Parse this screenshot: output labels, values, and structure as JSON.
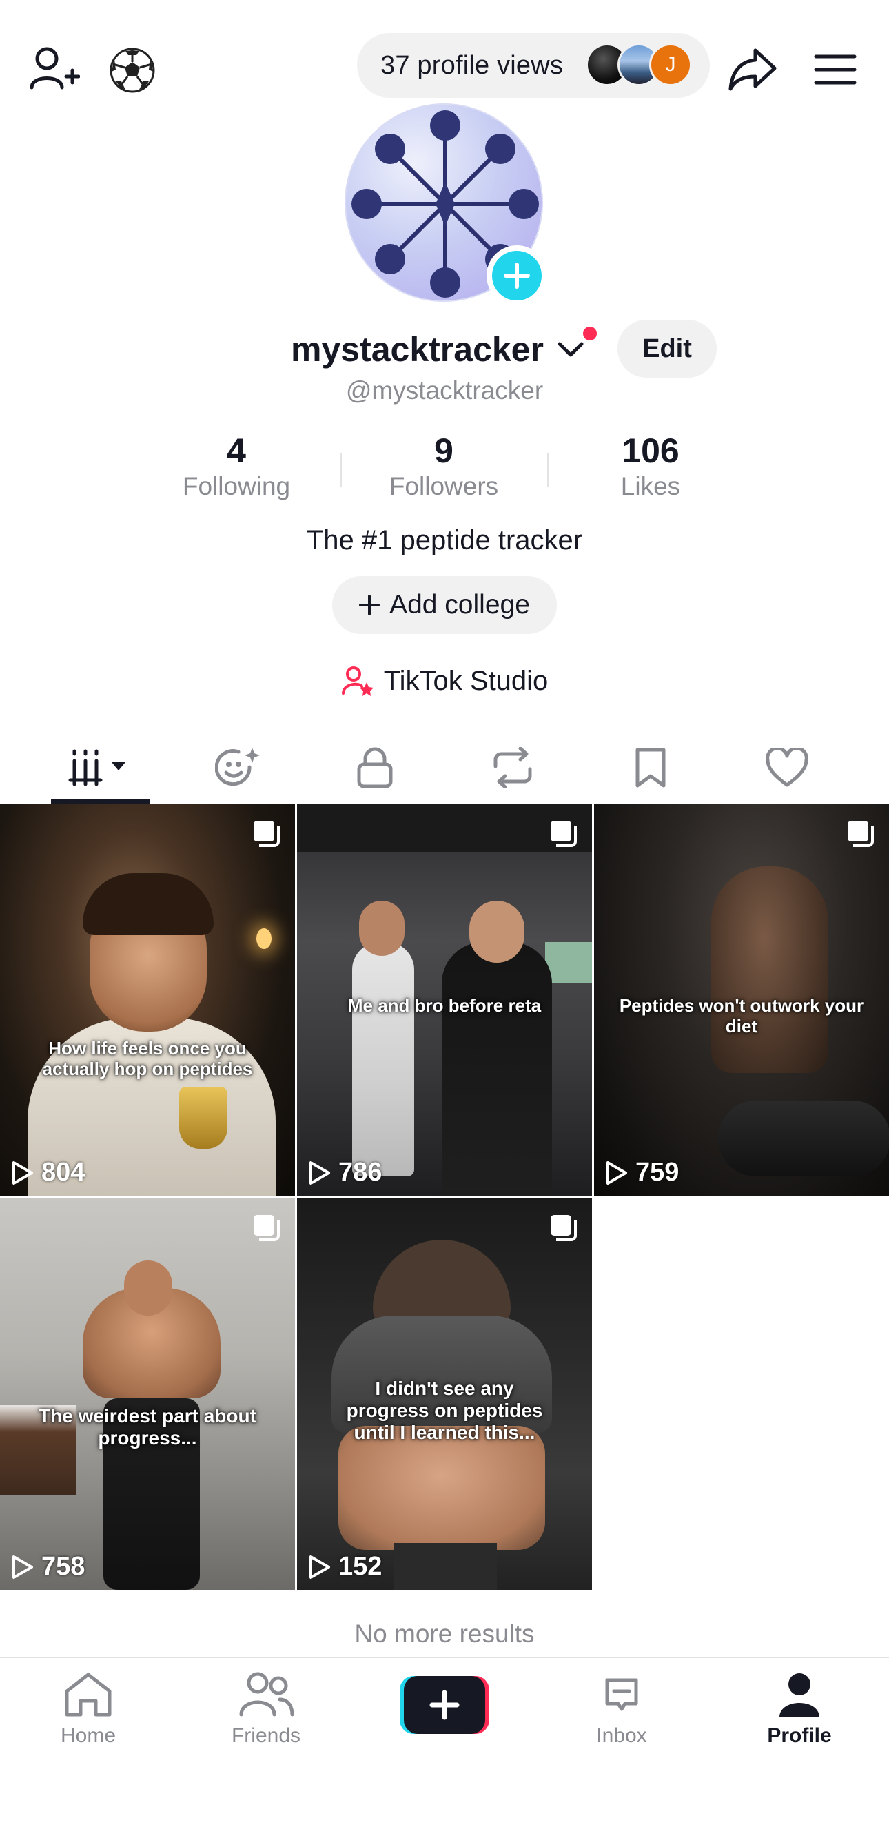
{
  "topbar": {
    "profile_views_label": "37 profile views",
    "viewer_initial": "J"
  },
  "profile": {
    "username": "mystacktracker",
    "handle": "@mystacktracker",
    "edit_label": "Edit",
    "bio": "The #1 peptide tracker",
    "add_college_label": "Add college",
    "studio_label": "TikTok Studio"
  },
  "stats": [
    {
      "value": "4",
      "label": "Following"
    },
    {
      "value": "9",
      "label": "Followers"
    },
    {
      "value": "106",
      "label": "Likes"
    }
  ],
  "videos": [
    {
      "caption": "How life feels once you actually hop on peptides",
      "plays": "804"
    },
    {
      "caption": "Me and bro before reta",
      "plays": "786"
    },
    {
      "caption": "Peptides won't outwork your diet",
      "plays": "759"
    },
    {
      "caption": "The weirdest part about progress...",
      "plays": "758"
    },
    {
      "caption": "I didn't see any progress on peptides until I learned this...",
      "plays": "152"
    }
  ],
  "footer_text": "No more results",
  "nav": {
    "home": "Home",
    "friends": "Friends",
    "inbox": "Inbox",
    "profile": "Profile"
  },
  "colors": {
    "accent_red": "#fe2c55",
    "accent_cyan": "#20d5ec",
    "text_primary": "#161823",
    "text_secondary": "#8a8b91"
  }
}
